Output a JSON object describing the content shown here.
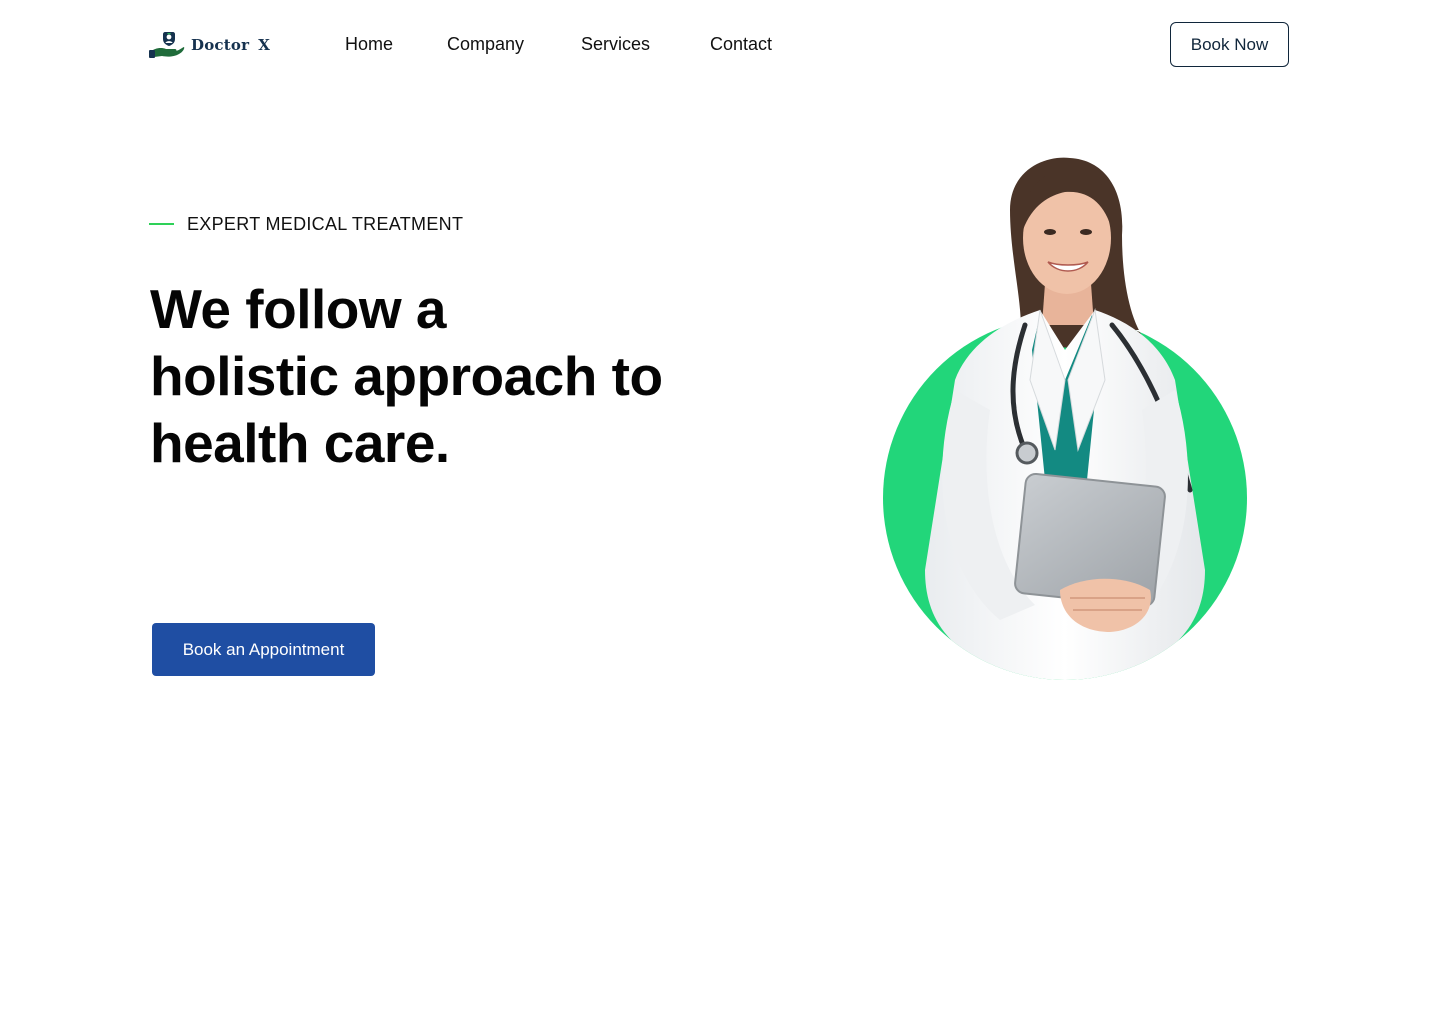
{
  "brand": {
    "name": "Doctor",
    "suffix": "X",
    "icon": "doctor-logo-icon",
    "colors": {
      "navy": "#16324f",
      "green": "#1f6b3a"
    }
  },
  "nav": {
    "items": [
      {
        "label": "Home"
      },
      {
        "label": "Company"
      },
      {
        "label": "Services"
      },
      {
        "label": "Contact"
      }
    ],
    "book_now_label": "Book Now"
  },
  "hero": {
    "eyebrow": "EXPERT MEDICAL TREATMENT",
    "headline_lines": [
      "We follow a",
      "holistic approach to",
      "health care."
    ],
    "cta_label": "Book an Appointment",
    "image": "doctor-portrait-image"
  },
  "colors": {
    "accent_green": "#2ed158",
    "circle_green": "#22d67a",
    "cta_blue": "#1f4ea3",
    "button_border": "#10263b",
    "text": "#050505"
  }
}
